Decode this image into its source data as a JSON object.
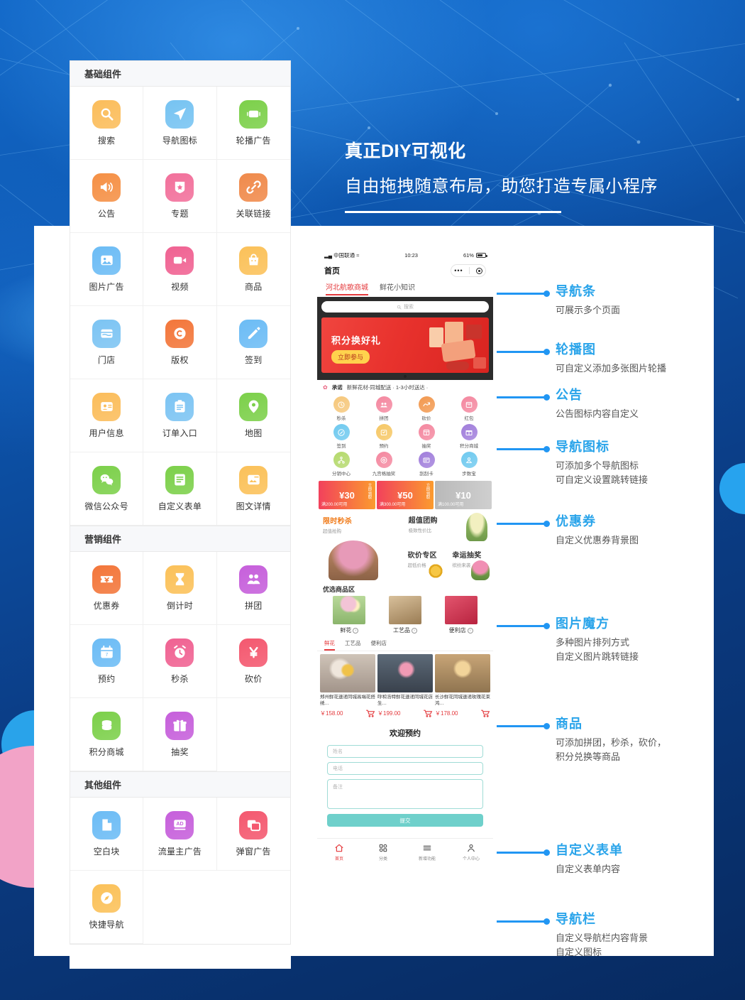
{
  "headline": {
    "line1": "真正DIY可视化",
    "line2": "自由拖拽随意布局，助您打造专属小程序"
  },
  "palette": [
    {
      "title": "基础组件",
      "items": [
        {
          "label": "搜索",
          "icon": "search-icon",
          "color": "#fbbd5b"
        },
        {
          "label": "导航图标",
          "icon": "navigation-icon",
          "color": "#76c3f2"
        },
        {
          "label": "轮播广告",
          "icon": "carousel-icon",
          "color": "#7cd04a"
        },
        {
          "label": "公告",
          "icon": "megaphone-icon",
          "color": "#f59045"
        },
        {
          "label": "专题",
          "icon": "badge-star-icon",
          "color": "#f2709b"
        },
        {
          "label": "关联链接",
          "icon": "link-icon",
          "color": "#f08a4b"
        },
        {
          "label": "图片广告",
          "icon": "image-icon",
          "color": "#6cbcf5"
        },
        {
          "label": "视频",
          "icon": "video-icon",
          "color": "#f06292"
        },
        {
          "label": "商品",
          "icon": "shopping-bag-icon",
          "color": "#fbc159"
        },
        {
          "label": "门店",
          "icon": "store-icon",
          "color": "#7cc4f3"
        },
        {
          "label": "版权",
          "icon": "copyright-icon",
          "color": "#f3763a"
        },
        {
          "label": "签到",
          "icon": "pencil-icon",
          "color": "#6cbcf5"
        },
        {
          "label": "用户信息",
          "icon": "user-card-icon",
          "color": "#fbbd5b"
        },
        {
          "label": "订单入口",
          "icon": "clipboard-icon",
          "color": "#7cc4f3"
        },
        {
          "label": "地图",
          "icon": "map-pin-icon",
          "color": "#7cd04a"
        },
        {
          "label": "微信公众号",
          "icon": "wechat-icon",
          "color": "#7cd04a"
        },
        {
          "label": "自定义表单",
          "icon": "form-icon",
          "color": "#7cd04a"
        },
        {
          "label": "图文详情",
          "icon": "article-image-icon",
          "color": "#fbc159"
        }
      ]
    },
    {
      "title": "营销组件",
      "items": [
        {
          "label": "优惠券",
          "icon": "coupon-icon",
          "color": "#f3763a"
        },
        {
          "label": "倒计时",
          "icon": "hourglass-icon",
          "color": "#fbc159"
        },
        {
          "label": "拼团",
          "icon": "group-buy-icon",
          "color": "#c65fdb"
        },
        {
          "label": "预约",
          "icon": "calendar-icon",
          "color": "#6cbcf5"
        },
        {
          "label": "秒杀",
          "icon": "alarm-clock-icon",
          "color": "#f06292"
        },
        {
          "label": "砍价",
          "icon": "bargain-yuan-icon",
          "color": "#f4586f"
        },
        {
          "label": "积分商城",
          "icon": "coins-icon",
          "color": "#7cd04a"
        },
        {
          "label": "抽奖",
          "icon": "gift-icon",
          "color": "#c65fdb"
        }
      ]
    },
    {
      "title": "其他组件",
      "items": [
        {
          "label": "空白块",
          "icon": "blank-page-icon",
          "color": "#6cbcf5"
        },
        {
          "label": "流量主广告",
          "icon": "ad-icon",
          "color": "#c65fdb"
        },
        {
          "label": "弹窗广告",
          "icon": "popup-icon",
          "color": "#f4586f"
        },
        {
          "label": "快捷导航",
          "icon": "compass-icon",
          "color": "#fbc159"
        }
      ]
    }
  ],
  "phone": {
    "status": {
      "carrier": "中国联通",
      "time": "10:23",
      "battery": "61%"
    },
    "title": "首页",
    "tabs": [
      {
        "label": "河北航歌商城",
        "active": true
      },
      {
        "label": "鲜花小知识",
        "active": false
      }
    ],
    "search_placeholder": "搜索",
    "banner": {
      "title": "积分换好礼",
      "button": "立即参与"
    },
    "notice": {
      "label": "承诺",
      "text": "新鲜花材-同城配送 · 1-3小时送达 ·"
    },
    "nav_icons": [
      {
        "label": "秒杀",
        "color": "#f6c77a"
      },
      {
        "label": "拼团",
        "color": "#f4879f"
      },
      {
        "label": "砍价",
        "color": "#f2984e"
      },
      {
        "label": "红包",
        "color": "#f4879f"
      },
      {
        "label": "签到",
        "color": "#6ec9ef"
      },
      {
        "label": "预约",
        "color": "#f6c764"
      },
      {
        "label": "抽奖",
        "color": "#f4879f"
      },
      {
        "label": "积分商城",
        "color": "#a07ddb"
      },
      {
        "label": "分销中心",
        "color": "#b4d96b"
      },
      {
        "label": "九宫格抽奖",
        "color": "#f4879f"
      },
      {
        "label": "刮刮卡",
        "color": "#a07ddb"
      },
      {
        "label": "步数宝",
        "color": "#6ec9ef"
      }
    ],
    "coupons": [
      {
        "amount": "¥30",
        "condition": "满200.00可用",
        "action": "立即领取"
      },
      {
        "amount": "¥50",
        "condition": "满300.00可用",
        "action": "立即领取"
      },
      {
        "amount": "¥10",
        "condition": "满100.00可用",
        "action": "立即领取"
      }
    ],
    "cube": [
      {
        "title": "限时秒杀",
        "sub": "超值抢购"
      },
      {
        "title": "超值团购",
        "sub": "极致性价比"
      },
      {
        "title": "砍价专区",
        "sub": "超低价格"
      },
      {
        "title": "幸运抽奖",
        "sub": "缤纷来袭"
      }
    ],
    "section_title": "优选商品区",
    "categories": [
      {
        "label": "鲜花"
      },
      {
        "label": "工艺品"
      },
      {
        "label": "便利店"
      }
    ],
    "subtabs": [
      {
        "label": "鲜花",
        "active": true
      },
      {
        "label": "工艺品",
        "active": false
      },
      {
        "label": "便利店",
        "active": false
      }
    ],
    "products": [
      {
        "title": "郑州鲜花速递同城高端花搭绣…",
        "price": "￥158.00"
      },
      {
        "title": "呼和浩特鲜花速递同城花店生…",
        "price": "￥199.00"
      },
      {
        "title": "长沙鲜花同城速递玫瑰花束鸿…",
        "price": "￥178.00"
      }
    ],
    "form": {
      "title": "欢迎预约",
      "fields": [
        {
          "placeholder": "姓名"
        },
        {
          "placeholder": "电话"
        },
        {
          "placeholder": "备注"
        }
      ],
      "submit": "提交"
    },
    "tabbar": [
      {
        "label": "首页",
        "icon": "home-icon",
        "active": true
      },
      {
        "label": "分类",
        "icon": "grid-icon",
        "active": false
      },
      {
        "label": "新增功能",
        "icon": "menu-icon",
        "active": false
      },
      {
        "label": "个人中心",
        "icon": "person-icon",
        "active": false
      }
    ]
  },
  "annotations": [
    {
      "title": "导航条",
      "desc": "可展示多个页面"
    },
    {
      "title": "轮播图",
      "desc": "可自定义添加多张图片轮播"
    },
    {
      "title": "公告",
      "desc": "公告图标内容自定义"
    },
    {
      "title": "导航图标",
      "desc": "可添加多个导航图标\n可自定义设置跳转链接"
    },
    {
      "title": "优惠券",
      "desc": "自定义优惠券背景图"
    },
    {
      "title": "图片魔方",
      "desc": "多种图片排列方式\n自定义图片跳转链接"
    },
    {
      "title": "商品",
      "desc": "可添加拼团，秒杀，砍价，\n积分兑换等商品"
    },
    {
      "title": "自定义表单",
      "desc": "自定义表单内容"
    },
    {
      "title": "导航栏",
      "desc": "自定义导航栏内容背景\n自定义图标"
    }
  ],
  "colors": {
    "accent": "#2aa4ea",
    "leader": "#2196f3",
    "brand_red": "#e4393c"
  }
}
